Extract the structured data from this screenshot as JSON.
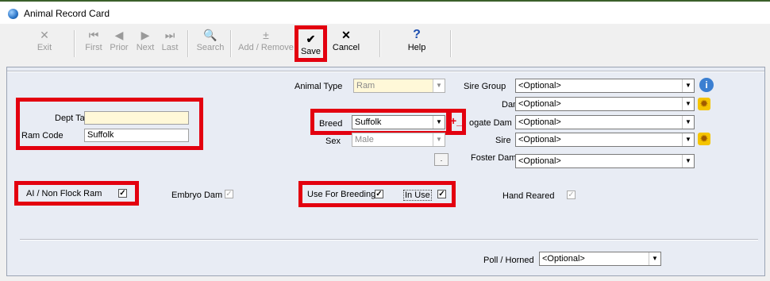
{
  "window": {
    "title": "Animal Record Card"
  },
  "toolbar": {
    "exit": "Exit",
    "first": "First",
    "prior": "Prior",
    "next": "Next",
    "last": "Last",
    "search": "Search",
    "add_remove": "Add / Remove",
    "save": "Save",
    "cancel": "Cancel",
    "help": "Help"
  },
  "form": {
    "dept_tag_label": "Dept Tag",
    "dept_tag_value": "",
    "ram_code_label": "Ram Code",
    "ram_code_value": "Suffolk",
    "animal_type_label": "Animal Type",
    "animal_type_value": "Ram",
    "breed_label": "Breed",
    "breed_value": "Suffolk",
    "sex_label": "Sex",
    "sex_value": "Male",
    "small_button": ".",
    "add_minus": "+_",
    "sire_group_label": "Sire Group",
    "sire_group_value": "<Optional>",
    "dam_label": "Dam",
    "dam_value": "<Optional>",
    "surrogate_dam_label": "ogate Dam",
    "surrogate_dam_value": "<Optional>",
    "sire_label": "Sire",
    "sire_value": "<Optional>",
    "foster_dam_label": "Foster Dam",
    "foster_dam_value": "<Optional>",
    "ai_label": "AI / Non Flock Ram",
    "embryo_dam_label": "Embryo Dam",
    "use_for_breeding_label": "Use For Breeding",
    "in_use_label": "In Use",
    "hand_reared_label": "Hand Reared",
    "poll_horned_label": "Poll / Horned",
    "poll_horned_value": "<Optional>"
  },
  "checkmark": "✓",
  "colors": {
    "highlight": "#e3000f",
    "panel": "#e8ecf4",
    "disabled_field": "#fff8d8"
  }
}
